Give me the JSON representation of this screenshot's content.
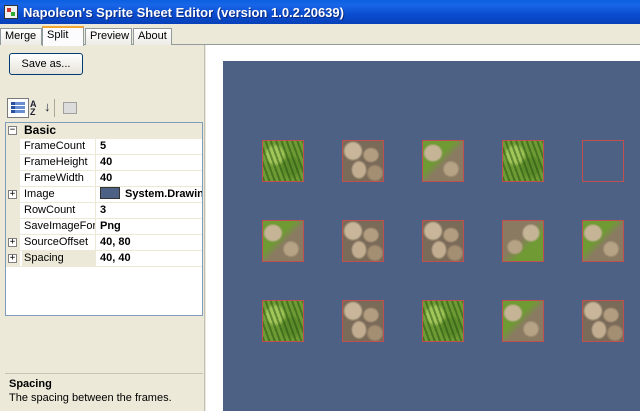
{
  "window": {
    "title": "Napoleon's Sprite Sheet Editor (version 1.0.2.20639)"
  },
  "tabs": [
    {
      "label": "Merge"
    },
    {
      "label": "Split"
    },
    {
      "label": "Preview"
    },
    {
      "label": "About"
    }
  ],
  "active_tab": "Split",
  "toolbar": {
    "save_label": "Save as..."
  },
  "property_grid": {
    "category": "Basic",
    "properties": [
      {
        "name": "FrameCount",
        "value": "5",
        "expandable": false
      },
      {
        "name": "FrameHeight",
        "value": "40",
        "expandable": false
      },
      {
        "name": "FrameWidth",
        "value": "40",
        "expandable": false
      },
      {
        "name": "Image",
        "value": "System.Drawing.Bitmap",
        "expandable": true,
        "swatch_color": "#4c6183"
      },
      {
        "name": "RowCount",
        "value": "3",
        "expandable": false
      },
      {
        "name": "SaveImageFormat",
        "value": "Png",
        "expandable": false
      },
      {
        "name": "SourceOffset",
        "value": "40, 80",
        "expandable": true
      },
      {
        "name": "Spacing",
        "value": "40, 40",
        "expandable": true,
        "selected": true
      }
    ]
  },
  "help": {
    "title": "Spacing",
    "description": "The spacing between the frames."
  },
  "canvas": {
    "background_color": "#4c6183",
    "frame_border_color": "#c05050",
    "rows": [
      [
        "grass",
        "stone",
        "mixed",
        "grass",
        "empty"
      ],
      [
        "mixed",
        "stone",
        "stone",
        "mixed2",
        "mixed"
      ],
      [
        "grass",
        "stone",
        "grass",
        "mixed",
        "stone"
      ]
    ]
  },
  "icons": {
    "app": "app-icon",
    "categorized": "categorized-icon",
    "alphabetical": "alphabetical-sort-icon",
    "property_pages": "property-pages-icon"
  }
}
